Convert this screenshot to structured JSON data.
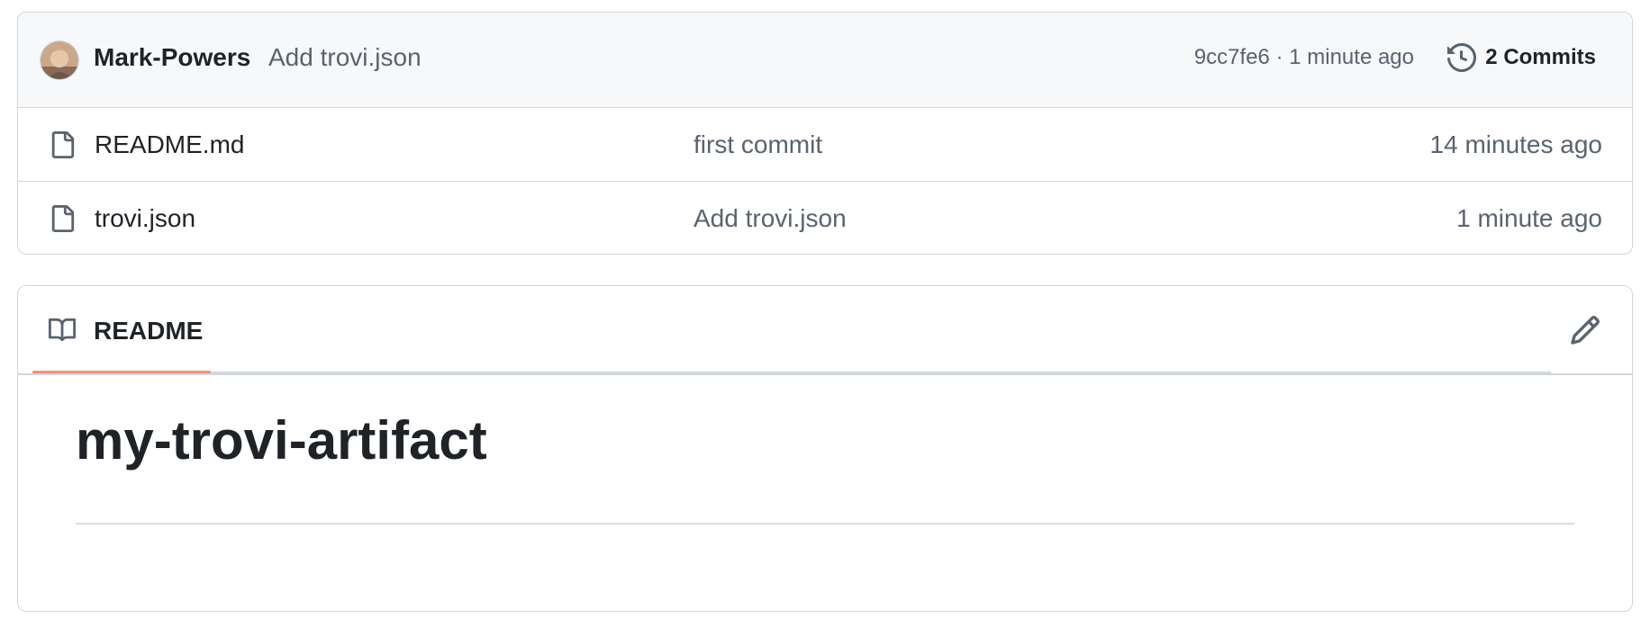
{
  "latest_commit": {
    "author": "Mark-Powers",
    "message": "Add trovi.json",
    "sha": "9cc7fe6",
    "separator": "·",
    "time": "1 minute ago",
    "commits_label": "2 Commits"
  },
  "files": [
    {
      "name": "README.md",
      "commit_message": "first commit",
      "time": "14 minutes ago",
      "icon": "file-icon"
    },
    {
      "name": "trovi.json",
      "commit_message": "Add trovi.json",
      "time": "1 minute ago",
      "icon": "file-icon"
    }
  ],
  "readme": {
    "tab_label": "README",
    "heading": "my-trovi-artifact",
    "tab_icon": "book-icon",
    "edit_icon": "pencil-icon"
  },
  "colors": {
    "tab_underline": "#fd8c73",
    "border": "#d0d7de",
    "header_bg": "#f6f8fa",
    "muted_text": "#59636e",
    "text": "#1f2328"
  }
}
